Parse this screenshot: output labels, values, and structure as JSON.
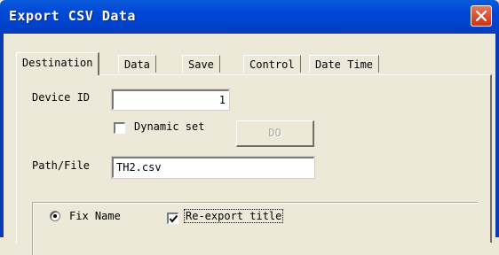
{
  "window": {
    "title": "Export CSV Data"
  },
  "tabs": [
    {
      "label": "Destination",
      "active": true
    },
    {
      "label": "Data",
      "active": false
    },
    {
      "label": "Save",
      "active": false
    },
    {
      "label": "Control",
      "active": false
    },
    {
      "label": "Date Time",
      "active": false
    }
  ],
  "destination": {
    "device_id_label": "Device ID",
    "device_id_value": "1",
    "dynamic_set_label": "Dynamic set",
    "dynamic_set_checked": false,
    "do_button_label": "DO",
    "path_label": "Path/File",
    "path_value": "TH2.csv",
    "fix_name_label": "Fix Name",
    "fix_name_selected": true,
    "reexport_title_label": "Re-export title",
    "reexport_title_checked": true
  },
  "icons": {
    "close": "close-icon",
    "check": "checkmark-icon"
  },
  "colors": {
    "titlebar": "#0046d5",
    "close_button": "#d54a2a",
    "dialog_bg": "#ece9d8"
  }
}
